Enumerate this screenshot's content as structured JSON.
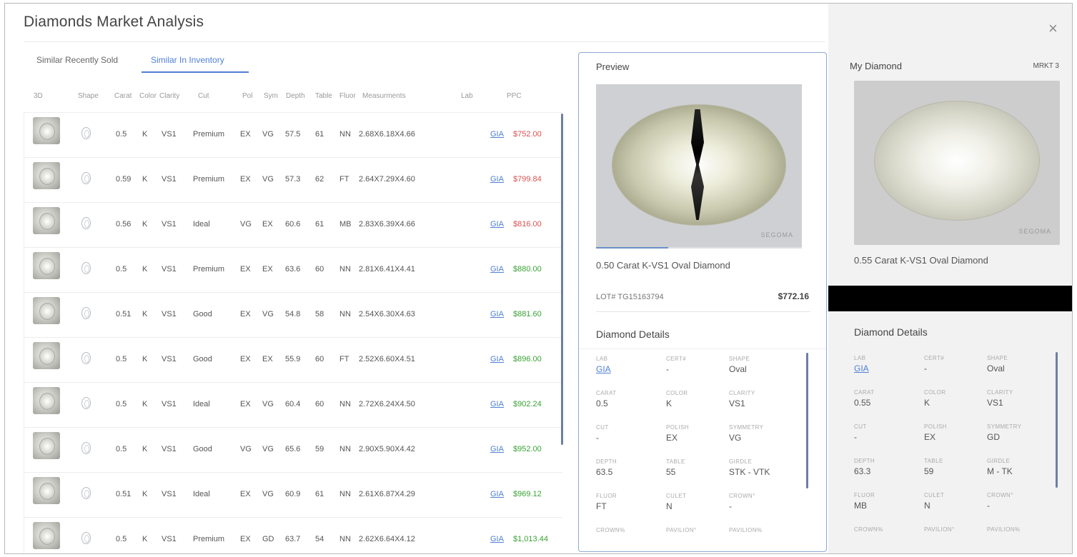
{
  "title": "Diamonds Market Analysis",
  "tabs": [
    {
      "label": "Similar Recently Sold",
      "active": false
    },
    {
      "label": "Similar In Inventory",
      "active": true
    }
  ],
  "colors": {
    "accent": "#4f7fd6",
    "ppc_high": "#d9534f",
    "ppc_low": "#3aa335"
  },
  "table": {
    "columns": [
      "3D",
      "Shape",
      "Carat",
      "Color",
      "Clarity",
      "Cut",
      "Pol",
      "Sym",
      "Depth",
      "Table",
      "Fluor",
      "Measurments",
      "Lab",
      "PPC"
    ],
    "rows": [
      {
        "carat": "0.5",
        "color": "K",
        "clarity": "VS1",
        "cut": "Premium",
        "pol": "EX",
        "sym": "VG",
        "depth": "57.5",
        "table": "61",
        "fluor": "NN",
        "meas": "2.68X6.18X4.66",
        "lab": "GIA",
        "ppc": "$752.00",
        "ppc_color": "red"
      },
      {
        "carat": "0.59",
        "color": "K",
        "clarity": "VS1",
        "cut": "Premium",
        "pol": "EX",
        "sym": "VG",
        "depth": "57.3",
        "table": "62",
        "fluor": "FT",
        "meas": "2.64X7.29X4.60",
        "lab": "GIA",
        "ppc": "$799.84",
        "ppc_color": "red"
      },
      {
        "carat": "0.56",
        "color": "K",
        "clarity": "VS1",
        "cut": "Ideal",
        "pol": "VG",
        "sym": "EX",
        "depth": "60.6",
        "table": "61",
        "fluor": "MB",
        "meas": "2.83X6.39X4.66",
        "lab": "GIA",
        "ppc": "$816.00",
        "ppc_color": "red"
      },
      {
        "carat": "0.5",
        "color": "K",
        "clarity": "VS1",
        "cut": "Premium",
        "pol": "EX",
        "sym": "EX",
        "depth": "63.6",
        "table": "60",
        "fluor": "NN",
        "meas": "2.81X6.41X4.41",
        "lab": "GIA",
        "ppc": "$880.00",
        "ppc_color": "green"
      },
      {
        "carat": "0.51",
        "color": "K",
        "clarity": "VS1",
        "cut": "Good",
        "pol": "EX",
        "sym": "VG",
        "depth": "54.8",
        "table": "58",
        "fluor": "NN",
        "meas": "2.54X6.30X4.63",
        "lab": "GIA",
        "ppc": "$881.60",
        "ppc_color": "green"
      },
      {
        "carat": "0.5",
        "color": "K",
        "clarity": "VS1",
        "cut": "Good",
        "pol": "EX",
        "sym": "EX",
        "depth": "55.9",
        "table": "60",
        "fluor": "FT",
        "meas": "2.52X6.60X4.51",
        "lab": "GIA",
        "ppc": "$896.00",
        "ppc_color": "green"
      },
      {
        "carat": "0.5",
        "color": "K",
        "clarity": "VS1",
        "cut": "Ideal",
        "pol": "EX",
        "sym": "VG",
        "depth": "60.4",
        "table": "60",
        "fluor": "NN",
        "meas": "2.72X6.24X4.50",
        "lab": "GIA",
        "ppc": "$902.24",
        "ppc_color": "green"
      },
      {
        "carat": "0.5",
        "color": "K",
        "clarity": "VS1",
        "cut": "Good",
        "pol": "VG",
        "sym": "VG",
        "depth": "65.6",
        "table": "59",
        "fluor": "NN",
        "meas": "2.90X5.90X4.42",
        "lab": "GIA",
        "ppc": "$952.00",
        "ppc_color": "green"
      },
      {
        "carat": "0.51",
        "color": "K",
        "clarity": "VS1",
        "cut": "Ideal",
        "pol": "EX",
        "sym": "VG",
        "depth": "60.9",
        "table": "61",
        "fluor": "NN",
        "meas": "2.61X6.87X4.29",
        "lab": "GIA",
        "ppc": "$969.12",
        "ppc_color": "green"
      },
      {
        "carat": "0.5",
        "color": "K",
        "clarity": "VS1",
        "cut": "Premium",
        "pol": "EX",
        "sym": "GD",
        "depth": "63.7",
        "table": "54",
        "fluor": "NN",
        "meas": "2.62X6.64X4.12",
        "lab": "GIA",
        "ppc": "$1,013.44",
        "ppc_color": "green"
      }
    ]
  },
  "preview": {
    "heading": "Preview",
    "brand": "SEGOMA",
    "progress": 0.35,
    "name": "0.50 Carat K-VS1 Oval Diamond",
    "lot": "LOT# TG15163794",
    "price": "$772.16",
    "details_title": "Diamond Details",
    "details": [
      {
        "k": "LAB",
        "v": "GIA",
        "link": true
      },
      {
        "k": "CERT#",
        "v": "-"
      },
      {
        "k": "SHAPE",
        "v": "Oval"
      },
      {
        "k": "CARAT",
        "v": "0.5"
      },
      {
        "k": "COLOR",
        "v": "K"
      },
      {
        "k": "CLARITY",
        "v": "VS1"
      },
      {
        "k": "CUT",
        "v": "-"
      },
      {
        "k": "POLISH",
        "v": "EX"
      },
      {
        "k": "SYMMETRY",
        "v": "VG"
      },
      {
        "k": "DEPTH",
        "v": "63.5"
      },
      {
        "k": "TABLE",
        "v": "55"
      },
      {
        "k": "GIRDLE",
        "v": "STK - VTK"
      },
      {
        "k": "FLUOR",
        "v": "FT"
      },
      {
        "k": "CULET",
        "v": "N"
      },
      {
        "k": "CROWN°",
        "v": "-"
      },
      {
        "k": "CROWN%",
        "v": ""
      },
      {
        "k": "PAVILION°",
        "v": ""
      },
      {
        "k": "PAVILION%",
        "v": ""
      }
    ]
  },
  "mine": {
    "heading": "My Diamond",
    "market": "MRKT 3",
    "close_icon": "×",
    "brand": "SEGOMA",
    "name": "0.55 Carat K-VS1 Oval Diamond",
    "details_title": "Diamond Details",
    "details": [
      {
        "k": "LAB",
        "v": "GIA",
        "link": true
      },
      {
        "k": "CERT#",
        "v": "-"
      },
      {
        "k": "SHAPE",
        "v": "Oval"
      },
      {
        "k": "CARAT",
        "v": "0.55"
      },
      {
        "k": "COLOR",
        "v": "K"
      },
      {
        "k": "CLARITY",
        "v": "VS1"
      },
      {
        "k": "CUT",
        "v": "-"
      },
      {
        "k": "POLISH",
        "v": "EX"
      },
      {
        "k": "SYMMETRY",
        "v": "GD"
      },
      {
        "k": "DEPTH",
        "v": "63.3"
      },
      {
        "k": "TABLE",
        "v": "59"
      },
      {
        "k": "GIRDLE",
        "v": "M - TK"
      },
      {
        "k": "FLUOR",
        "v": "MB"
      },
      {
        "k": "CULET",
        "v": "N"
      },
      {
        "k": "CROWN°",
        "v": "-"
      },
      {
        "k": "CROWN%",
        "v": ""
      },
      {
        "k": "PAVILION°",
        "v": ""
      },
      {
        "k": "PAVILION%",
        "v": ""
      }
    ]
  }
}
